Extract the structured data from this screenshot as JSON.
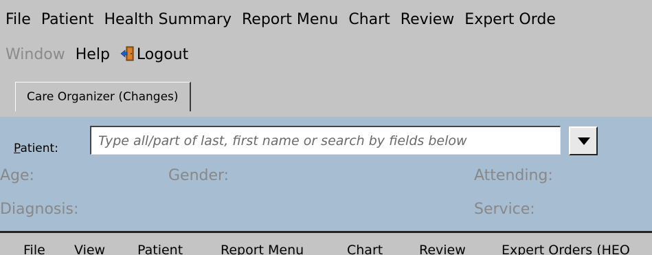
{
  "menu": {
    "row1": [
      "File",
      "Patient",
      "Health Summary",
      "Report Menu",
      "Chart",
      "Review",
      "Expert Orde"
    ],
    "window": "Window",
    "help": "Help",
    "logout": "Logout"
  },
  "tabs": [
    {
      "label": "Care Organizer (Changes)",
      "active": true
    }
  ],
  "patient": {
    "label_prefix": "P",
    "label_rest": "atient:",
    "placeholder": "Type all/part of last, first name or search by fields below"
  },
  "info": {
    "age": "Age:",
    "gender": "Gender:",
    "attending": "Attending:",
    "diagnosis": "Diagnosis:",
    "service": "Service:"
  },
  "bottom_menu": [
    "File",
    "View",
    "Patient",
    "Report Menu",
    "Chart",
    "Review",
    "Expert Orders (HEO"
  ],
  "colors": {
    "background": "#c4c4c4",
    "panel": "#a7bdd2",
    "disabled_text": "#888888"
  },
  "icons": {
    "logout": "door-exit-icon",
    "dropdown": "triangle-down-icon"
  }
}
